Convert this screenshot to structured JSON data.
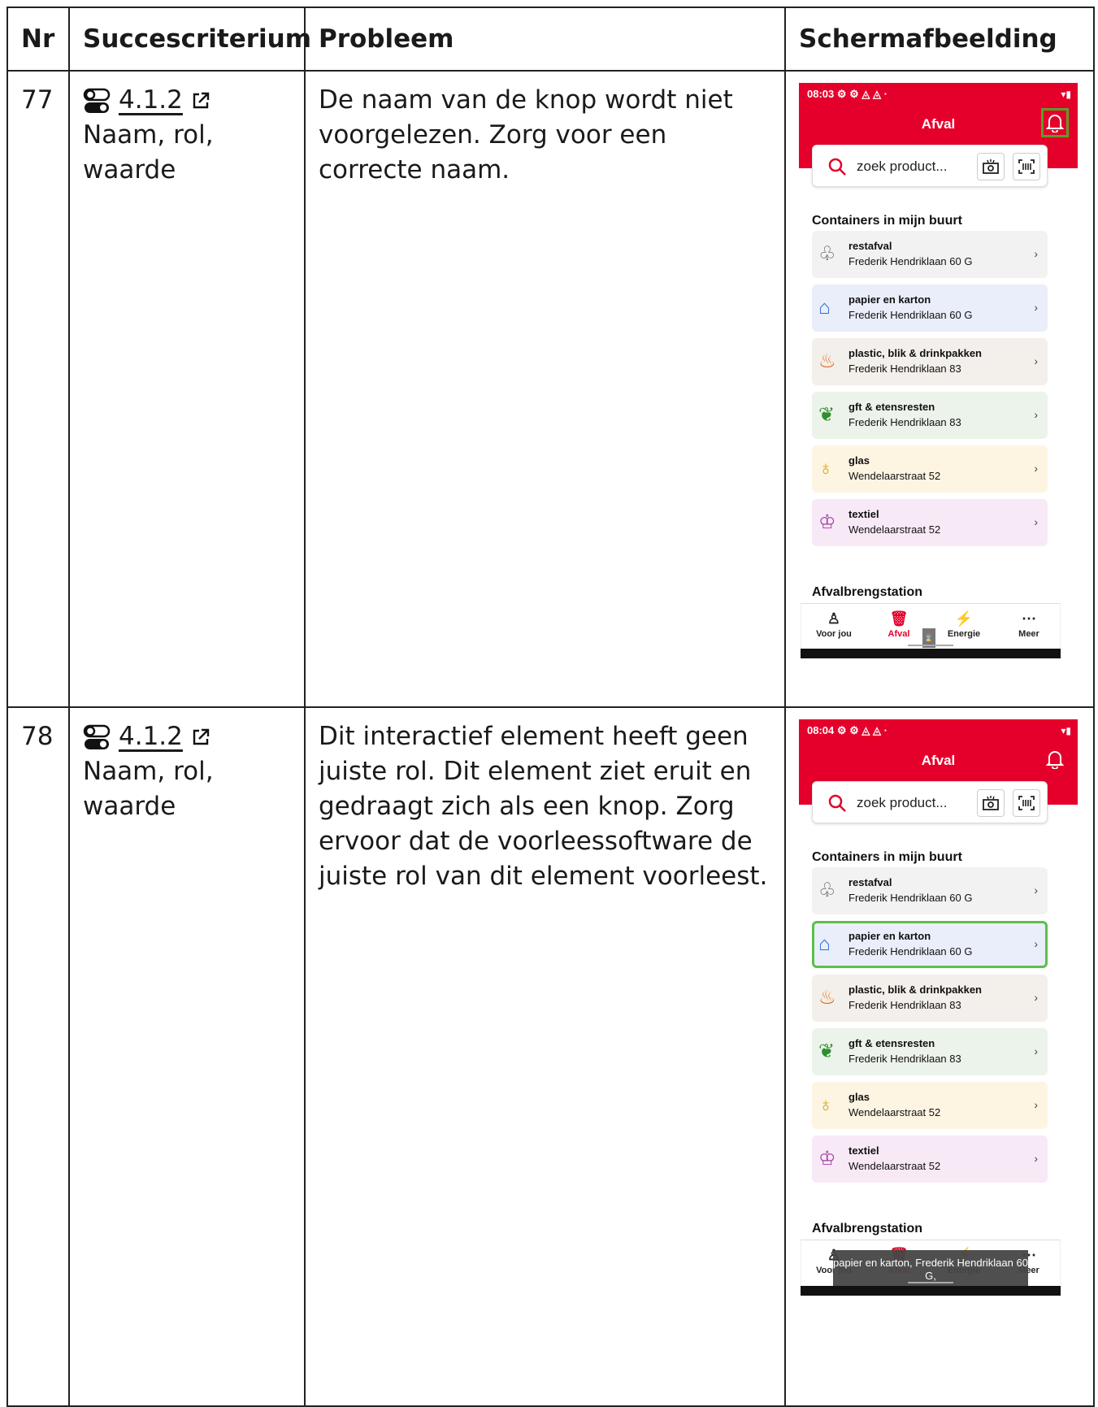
{
  "table": {
    "headers": [
      "Nr",
      "Succescriterium",
      "Probleem",
      "Schermafbeelding"
    ],
    "rows": [
      {
        "nr": "77",
        "criterion_code": "4.1.2",
        "criterion_name": "Naam, rol, waarde",
        "problem": "De naam van de knop wordt niet voorgelezen. Zorg voor een correcte naam.",
        "screenshot": {
          "time": "08:03",
          "status_icons": "⚙ ⚙ ◬ ◬ ·",
          "battery": "▾▮",
          "title": "Afval",
          "search_placeholder": "zoek product...",
          "section1": "Containers in mijn buurt",
          "section2": "Afvalbrengstation",
          "cards": [
            {
              "name": "restafval",
              "address": "Frederik Hendriklaan 60 G",
              "bg": "#f2f2f2"
            },
            {
              "name": "papier en karton",
              "address": "Frederik Hendriklaan 60 G",
              "bg": "#e9eefa"
            },
            {
              "name": "plastic, blik & drinkpakken",
              "address": "Frederik Hendriklaan 83",
              "bg": "#f3efea"
            },
            {
              "name": "gft & etensresten",
              "address": "Frederik Hendriklaan 83",
              "bg": "#ecf3ea"
            },
            {
              "name": "glas",
              "address": "Wendelaarstraat 52",
              "bg": "#fdf4e2"
            },
            {
              "name": "textiel",
              "address": "Wendelaarstraat 52",
              "bg": "#f8e9f7"
            }
          ],
          "nav": [
            "Voor jou",
            "Afval",
            "Energie",
            "Meer"
          ]
        }
      },
      {
        "nr": "78",
        "criterion_code": "4.1.2",
        "criterion_name": "Naam, rol, waarde",
        "problem": "Dit interactief element heeft geen juiste rol. Dit element ziet eruit en gedraagt zich als een knop. Zorg ervoor dat de voorleessoftware de juiste rol van dit element voorleest.",
        "screenshot": {
          "time": "08:04",
          "status_icons": "⚙ ⚙ ◬ ◬ ·",
          "battery": "▾▮",
          "title": "Afval",
          "search_placeholder": "zoek product...",
          "section1": "Containers in mijn buurt",
          "section2": "Afvalbrengstation",
          "cards": [
            {
              "name": "restafval",
              "address": "Frederik Hendriklaan 60 G",
              "bg": "#f2f2f2"
            },
            {
              "name": "papier en karton",
              "address": "Frederik Hendriklaan 60 G",
              "bg": "#e9eefa"
            },
            {
              "name": "plastic, blik & drinkpakken",
              "address": "Frederik Hendriklaan 83",
              "bg": "#f3efea"
            },
            {
              "name": "gft & etensresten",
              "address": "Frederik Hendriklaan 83",
              "bg": "#ecf3ea"
            },
            {
              "name": "glas",
              "address": "Wendelaarstraat 52",
              "bg": "#fdf4e2"
            },
            {
              "name": "textiel",
              "address": "Wendelaarstraat 52",
              "bg": "#f8e9f7"
            }
          ],
          "nav": [
            "Voor jou",
            "Afval",
            "Energie",
            "Meer"
          ],
          "tooltip": "papier en karton, Frederik Hendriklaan 60 G,"
        }
      }
    ]
  },
  "colors": {
    "brand_red": "#e4002b",
    "focus_green": "#5cbf4a"
  }
}
